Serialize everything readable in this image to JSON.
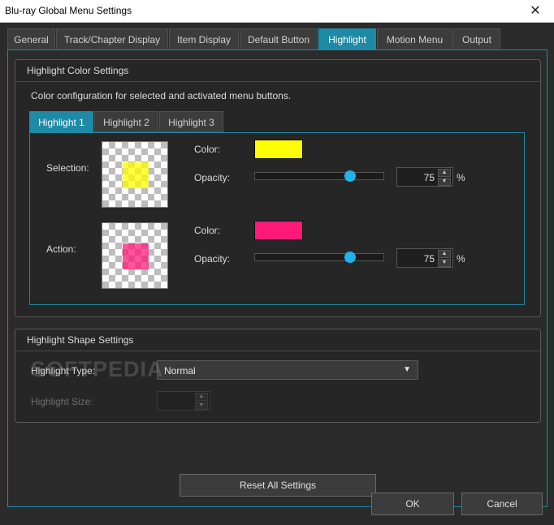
{
  "window": {
    "title": "Blu-ray Global Menu Settings",
    "close_glyph": "✕"
  },
  "tabs": [
    {
      "label": "General"
    },
    {
      "label": "Track/Chapter Display"
    },
    {
      "label": "Item Display"
    },
    {
      "label": "Default Button"
    },
    {
      "label": "Highlight"
    },
    {
      "label": "Motion Menu"
    },
    {
      "label": "Output"
    }
  ],
  "active_tab": "Highlight",
  "highlight_color": {
    "title": "Highlight Color Settings",
    "description": "Color configuration for selected and activated menu buttons.",
    "subtabs": [
      {
        "label": "Highlight 1"
      },
      {
        "label": "Highlight 2"
      },
      {
        "label": "Highlight 3"
      }
    ],
    "active_subtab": "Highlight 1",
    "selection": {
      "label": "Selection:",
      "color_label": "Color:",
      "color": "#ffff00",
      "opacity_label": "Opacity:",
      "opacity": "75",
      "opacity_fraction": 0.75,
      "unit": "%"
    },
    "action": {
      "label": "Action:",
      "color_label": "Color:",
      "color": "#ff1a7a",
      "opacity_label": "Opacity:",
      "opacity": "75",
      "opacity_fraction": 0.75,
      "unit": "%"
    }
  },
  "highlight_shape": {
    "title": "Highlight Shape Settings",
    "type_label": "Highlight Type:",
    "type_value": "Normal",
    "size_label": "Highlight Size:",
    "size_value": ""
  },
  "watermark": "SOFTPEDIA",
  "buttons": {
    "reset": "Reset All Settings",
    "ok": "OK",
    "cancel": "Cancel"
  },
  "colors": {
    "accent": "#1e8aa6",
    "slider_knob": "#1fb3e8"
  },
  "icons": {
    "close": "close-icon",
    "dropdown": "chevron-down-icon",
    "spin_up": "arrow-up-icon",
    "spin_down": "arrow-down-icon"
  }
}
